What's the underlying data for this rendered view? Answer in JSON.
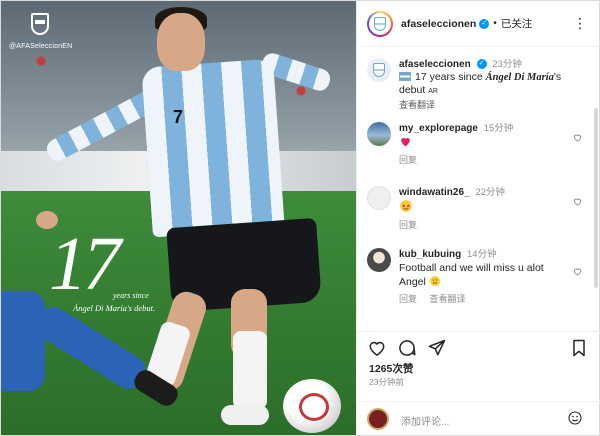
{
  "photo": {
    "handle": "@AFASeleccionEN",
    "overlay_number": "17",
    "overlay_line1": "years since",
    "overlay_line2": "Ángel Di María's debut."
  },
  "header": {
    "username": "afaseleccionen",
    "separator": "•",
    "follow_label": "已关注",
    "more_label": "⋮"
  },
  "caption": {
    "username": "afaseleccionen",
    "time": "23分钟",
    "text_prefix": "17 years since",
    "text_name": "Ángel Di María",
    "text_suffix": "'s",
    "text_line2": "debut",
    "text_ar": "AR",
    "translate": "查看翻译"
  },
  "comments": [
    {
      "username": "my_explorepage",
      "time": "15分钟",
      "text": "",
      "emoji": "red-heart",
      "reply": "回复",
      "translate": ""
    },
    {
      "username": "windawatin26_",
      "time": "22分钟",
      "text": "",
      "emoji": "star-struck",
      "reply": "回复",
      "translate": ""
    },
    {
      "username": "kub_kubuing",
      "time": "14分钟",
      "text": "Football and we will miss u alot Angel",
      "emoji": "sad-face",
      "reply": "回复",
      "translate": "查看翻译"
    }
  ],
  "stats": {
    "likes": "1265次赞",
    "ago": "23分钟前"
  },
  "add_comment": {
    "placeholder": "添加评论..."
  },
  "colors": {
    "verified_blue": "#0095f6",
    "heart_red": "#ed4956",
    "muted_text": "#8e8e8e"
  }
}
